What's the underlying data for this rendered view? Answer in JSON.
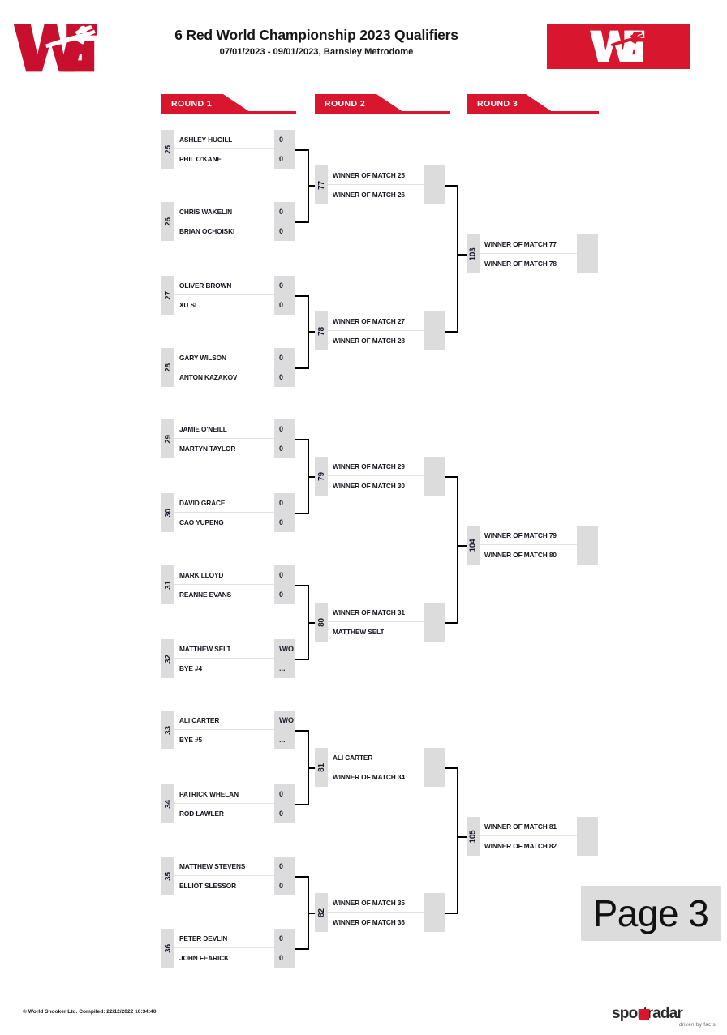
{
  "header": {
    "title": "6 Red World Championship 2023 Qualifiers",
    "subtitle": "07/01/2023 - 09/01/2023, Barnsley Metrodome",
    "logo_left": "wst-logo",
    "logo_right": "wst-logo-inverted",
    "brand_red": "#d8172f"
  },
  "rounds": [
    {
      "label": "ROUND 1"
    },
    {
      "label": "ROUND 2"
    },
    {
      "label": "ROUND 3"
    }
  ],
  "page_label": "Page 3",
  "footer": {
    "copyright": "© World Snooker Ltd. Compiled: 22/12/2022 10:34:40",
    "sportradar_word": "sportradar",
    "sportradar_tagline": "driven by facts"
  },
  "matches": {
    "m25": {
      "number": "25",
      "top_name": "ASHLEY HUGILL",
      "top_score": "0",
      "bot_name": "PHIL O'KANE",
      "bot_score": "0"
    },
    "m26": {
      "number": "26",
      "top_name": "CHRIS WAKELIN",
      "top_score": "0",
      "bot_name": "BRIAN OCHOISKI",
      "bot_score": "0"
    },
    "m27": {
      "number": "27",
      "top_name": "OLIVER BROWN",
      "top_score": "0",
      "bot_name": "XU SI",
      "bot_score": "0"
    },
    "m28": {
      "number": "28",
      "top_name": "GARY WILSON",
      "top_score": "0",
      "bot_name": "ANTON KAZAKOV",
      "bot_score": "0"
    },
    "m29": {
      "number": "29",
      "top_name": "JAMIE O'NEILL",
      "top_score": "0",
      "bot_name": "MARTYN TAYLOR",
      "bot_score": "0"
    },
    "m30": {
      "number": "30",
      "top_name": "DAVID GRACE",
      "top_score": "0",
      "bot_name": "CAO YUPENG",
      "bot_score": "0"
    },
    "m31": {
      "number": "31",
      "top_name": "MARK LLOYD",
      "top_score": "0",
      "bot_name": "REANNE EVANS",
      "bot_score": "0"
    },
    "m32": {
      "number": "32",
      "top_name": "MATTHEW SELT",
      "top_score": "W/O",
      "bot_name": "BYE #4",
      "bot_score": "..."
    },
    "m33": {
      "number": "33",
      "top_name": "ALI CARTER",
      "top_score": "W/O",
      "bot_name": "BYE #5",
      "bot_score": "..."
    },
    "m34": {
      "number": "34",
      "top_name": "PATRICK WHELAN",
      "top_score": "0",
      "bot_name": "ROD LAWLER",
      "bot_score": "0"
    },
    "m35": {
      "number": "35",
      "top_name": "MATTHEW STEVENS",
      "top_score": "0",
      "bot_name": "ELLIOT SLESSOR",
      "bot_score": "0"
    },
    "m36": {
      "number": "36",
      "top_name": "PETER DEVLIN",
      "top_score": "0",
      "bot_name": "JOHN FEARICK",
      "bot_score": "0"
    },
    "m77": {
      "number": "77",
      "top_name": "WINNER OF MATCH 25",
      "top_score": "",
      "bot_name": "WINNER OF MATCH 26",
      "bot_score": ""
    },
    "m78": {
      "number": "78",
      "top_name": "WINNER OF MATCH 27",
      "top_score": "",
      "bot_name": "WINNER OF MATCH 28",
      "bot_score": ""
    },
    "m79": {
      "number": "79",
      "top_name": "WINNER OF MATCH 29",
      "top_score": "",
      "bot_name": "WINNER OF MATCH 30",
      "bot_score": ""
    },
    "m80": {
      "number": "80",
      "top_name": "WINNER OF MATCH 31",
      "top_score": "",
      "bot_name": "MATTHEW SELT",
      "bot_score": ""
    },
    "m81": {
      "number": "81",
      "top_name": "ALI CARTER",
      "top_score": "",
      "bot_name": "WINNER OF MATCH 34",
      "bot_score": ""
    },
    "m82": {
      "number": "82",
      "top_name": "WINNER OF MATCH 35",
      "top_score": "",
      "bot_name": "WINNER OF MATCH 36",
      "bot_score": ""
    },
    "m103": {
      "number": "103",
      "top_name": "WINNER OF MATCH 77",
      "top_score": "",
      "bot_name": "WINNER OF MATCH 78",
      "bot_score": ""
    },
    "m104": {
      "number": "104",
      "top_name": "WINNER OF MATCH 79",
      "top_score": "",
      "bot_name": "WINNER OF MATCH 80",
      "bot_score": ""
    },
    "m105": {
      "number": "105",
      "top_name": "WINNER OF MATCH 81",
      "top_score": "",
      "bot_name": "WINNER OF MATCH 82",
      "bot_score": ""
    }
  }
}
